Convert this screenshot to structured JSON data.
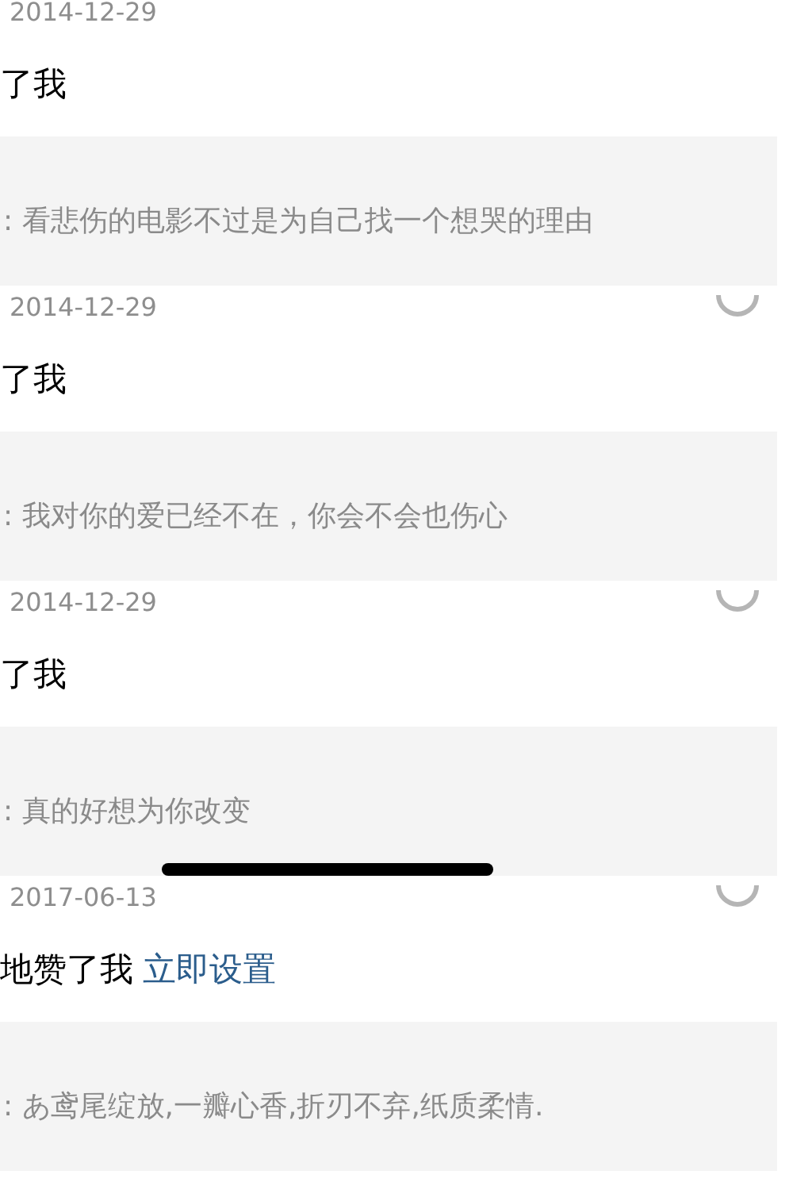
{
  "notifications": [
    {
      "date": "2014-12-29",
      "heading": "了我",
      "quote": ": 看悲伤的电影不过是为自己找一个想哭的理由",
      "icon": false
    },
    {
      "date": "2014-12-29",
      "heading": "了我",
      "quote": ": 我对你的爱已经不在，你会不会也伤心",
      "icon": true
    },
    {
      "date": "2014-12-29",
      "heading": "了我",
      "quote": ": 真的好想为你改变",
      "icon": true
    },
    {
      "date": "2017-06-13",
      "heading": "地赞了我",
      "link": "立即设置",
      "quote": ": あ鸢尾绽放,一瓣心香,折刃不弃,纸质柔情.",
      "icon": true
    }
  ]
}
